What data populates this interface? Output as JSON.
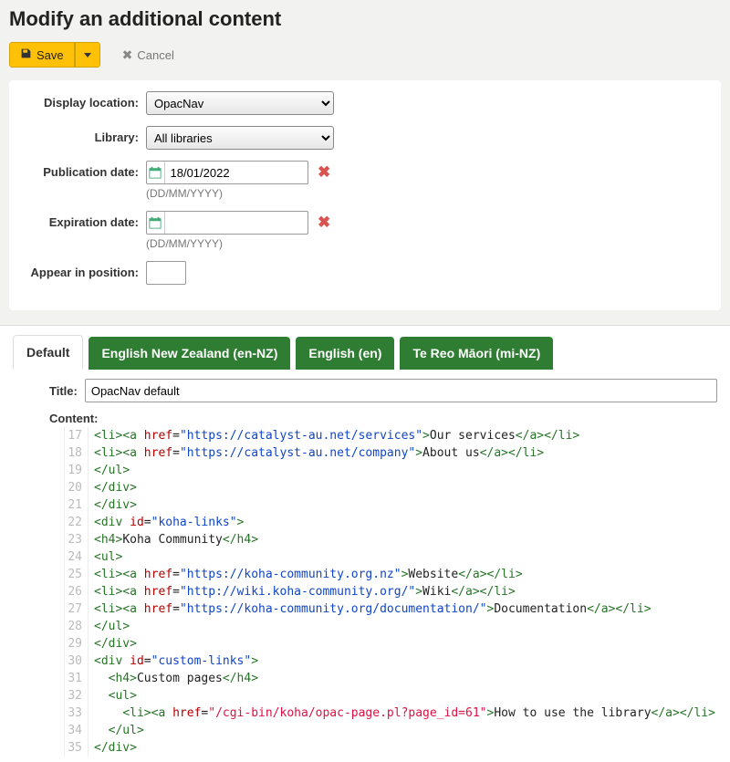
{
  "page_title": "Modify an additional content",
  "toolbar": {
    "save_label": "Save",
    "cancel_label": "Cancel"
  },
  "form": {
    "display_location": {
      "label": "Display location:",
      "value": "OpacNav"
    },
    "library": {
      "label": "Library:",
      "value": "All libraries"
    },
    "publication_date": {
      "label": "Publication date:",
      "value": "18/01/2022",
      "hint": "(DD/MM/YYYY)"
    },
    "expiration_date": {
      "label": "Expiration date:",
      "value": "",
      "hint": "(DD/MM/YYYY)"
    },
    "appear_position": {
      "label": "Appear in position:",
      "value": ""
    }
  },
  "tabs": {
    "default": "Default",
    "en_nz": "English New Zealand (en-NZ)",
    "en": "English (en)",
    "mi_nz": "Te Reo Māori (mi-NZ)"
  },
  "editor": {
    "title_label": "Title:",
    "title_value": "OpacNav default",
    "content_label": "Content:"
  },
  "chart_data": {
    "type": "table",
    "description": "HTML source snippet shown in code editor (line numbers 17-35)",
    "lines": [
      {
        "n": 17,
        "text": "<li><a href=\"https://catalyst-au.net/services\">Our services</a></li>"
      },
      {
        "n": 18,
        "text": "<li><a href=\"https://catalyst-au.net/company\">About us</a></li>"
      },
      {
        "n": 19,
        "text": "</ul>"
      },
      {
        "n": 20,
        "text": "</div>"
      },
      {
        "n": 21,
        "text": "</div>"
      },
      {
        "n": 22,
        "text": "<div id=\"koha-links\">"
      },
      {
        "n": 23,
        "text": "<h4>Koha Community</h4>"
      },
      {
        "n": 24,
        "text": "<ul>"
      },
      {
        "n": 25,
        "text": "<li><a href=\"https://koha-community.org.nz\">Website</a></li>"
      },
      {
        "n": 26,
        "text": "<li><a href=\"http://wiki.koha-community.org/\">Wiki</a></li>"
      },
      {
        "n": 27,
        "text": "<li><a href=\"https://koha-community.org/documentation/\">Documentation</a></li>"
      },
      {
        "n": 28,
        "text": "</ul>"
      },
      {
        "n": 29,
        "text": "</div>"
      },
      {
        "n": 30,
        "text": "<div id=\"custom-links\">"
      },
      {
        "n": 31,
        "text": "  <h4>Custom pages</h4>"
      },
      {
        "n": 32,
        "text": "  <ul>"
      },
      {
        "n": 33,
        "text": "    <li><a href=\"/cgi-bin/koha/opac-page.pl?page_id=61\">How to use the library</a></li>"
      },
      {
        "n": 34,
        "text": "  </ul>"
      },
      {
        "n": 35,
        "text": "</div>"
      }
    ]
  }
}
